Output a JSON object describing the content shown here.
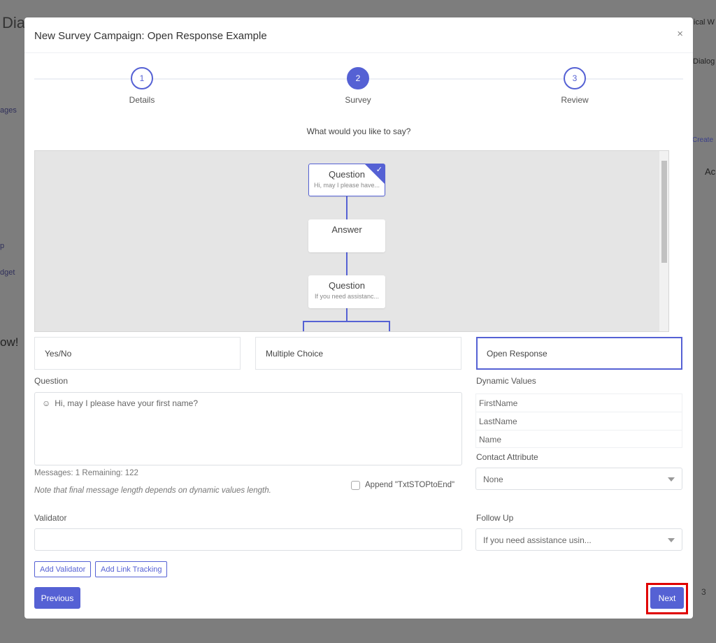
{
  "background": {
    "brand": "Dia",
    "sidebar_link": "ages",
    "sidebar_p": "p",
    "sidebar_widget": "dget",
    "promo": "ow!",
    "user": "ical W",
    "header_right": "Dialog",
    "create": "Create",
    "col": "Ac",
    "page": "3"
  },
  "modal": {
    "title": "New Survey Campaign: Open Response Example",
    "close": "×",
    "steps": [
      {
        "num": "1",
        "label": "Details"
      },
      {
        "num": "2",
        "label": "Survey",
        "active": true
      },
      {
        "num": "3",
        "label": "Review"
      }
    ],
    "prompt": "What would you like to say?",
    "flow": [
      {
        "title": "Question",
        "subtitle": "Hi, may I please have...",
        "selected": true
      },
      {
        "title": "Answer",
        "subtitle": ""
      },
      {
        "title": "Question",
        "subtitle": "If you need assistanc..."
      }
    ],
    "types": [
      "Yes/No",
      "Multiple Choice",
      "Open Response"
    ],
    "selected_type": "Open Response",
    "question_label": "Question",
    "question_value": "Hi, may I please have your first name?",
    "counter": "Messages: 1 Remaining: 122",
    "note": "Note that final message length depends on dynamic values length.",
    "append_label": "Append \"TxtSTOPtoEnd\"",
    "append_checked": false,
    "dynamic_label": "Dynamic Values",
    "dynamic_values": [
      "FirstName",
      "LastName",
      "Name"
    ],
    "contact_attr_label": "Contact Attribute",
    "contact_attr_value": "None",
    "validator_label": "Validator",
    "validator_value": "",
    "follow_up_label": "Follow Up",
    "follow_up_value": "If you need assistance usin...",
    "add_validator": "Add Validator",
    "add_link_tracking": "Add Link Tracking",
    "previous": "Previous",
    "next": "Next"
  },
  "colors": {
    "accent": "#5561d4",
    "highlight": "#e00000"
  }
}
